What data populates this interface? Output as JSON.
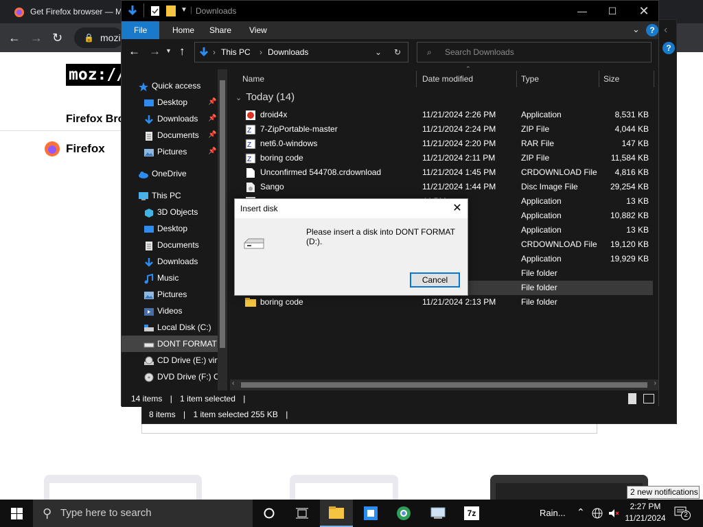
{
  "firefox": {
    "tab_title": "Get Firefox browser — M",
    "url_fragment": "mozil",
    "logo_text": "moz://a",
    "heading": "Firefox Bro",
    "brand": "Firefox"
  },
  "explorer_back": {
    "status_items": "8 items",
    "status_selected": "1 item selected  255 KB"
  },
  "explorer": {
    "title": "Downloads",
    "ribbon_tabs": [
      "File",
      "Home",
      "Share",
      "View"
    ],
    "breadcrumb": [
      "This PC",
      "Downloads"
    ],
    "search_placeholder": "Search Downloads",
    "nav": [
      {
        "label": "Quick access",
        "icon": "star-icon"
      },
      {
        "label": "Desktop",
        "icon": "desktop-folder-icon",
        "pinned": true
      },
      {
        "label": "Downloads",
        "icon": "download-arrow-icon",
        "pinned": true
      },
      {
        "label": "Documents",
        "icon": "documents-icon",
        "pinned": true
      },
      {
        "label": "Pictures",
        "icon": "pictures-icon",
        "pinned": true
      },
      {
        "label": "OneDrive",
        "icon": "cloud-icon"
      },
      {
        "label": "This PC",
        "icon": "computer-icon"
      },
      {
        "label": "3D Objects",
        "icon": "cube-icon"
      },
      {
        "label": "Desktop",
        "icon": "desktop-folder-icon"
      },
      {
        "label": "Documents",
        "icon": "documents-icon"
      },
      {
        "label": "Downloads",
        "icon": "download-arrow-icon"
      },
      {
        "label": "Music",
        "icon": "music-icon"
      },
      {
        "label": "Pictures",
        "icon": "pictures-icon"
      },
      {
        "label": "Videos",
        "icon": "videos-icon"
      },
      {
        "label": "Local Disk (C:)",
        "icon": "local-disk-icon"
      },
      {
        "label": "DONT FORMAT (",
        "icon": "removable-drive-icon",
        "selected": true
      },
      {
        "label": "CD Drive (E:) virt",
        "icon": "cd-drive-icon"
      },
      {
        "label": "DVD Drive (F:) Cl",
        "icon": "dvd-drive-icon"
      }
    ],
    "columns": [
      "Name",
      "Date modified",
      "Type",
      "Size"
    ],
    "group_label": "Today (14)",
    "files": [
      {
        "name": "droid4x",
        "date": "11/21/2024 2:26 PM",
        "type": "Application",
        "size": "8,531 KB",
        "icon": "app-icon"
      },
      {
        "name": "7-ZipPortable-master",
        "date": "11/21/2024 2:24 PM",
        "type": "ZIP File",
        "size": "4,044 KB",
        "icon": "archive-icon"
      },
      {
        "name": "net6.0-windows",
        "date": "11/21/2024 2:20 PM",
        "type": "RAR File",
        "size": "147 KB",
        "icon": "archive-icon"
      },
      {
        "name": "boring code",
        "date": "11/21/2024 2:11 PM",
        "type": "ZIP File",
        "size": "11,584 KB",
        "icon": "archive-icon"
      },
      {
        "name": "Unconfirmed 544708.crdownload",
        "date": "11/21/2024 1:45 PM",
        "type": "CRDOWNLOAD File",
        "size": "4,816 KB",
        "icon": "file-icon"
      },
      {
        "name": "Sango",
        "date": "11/21/2024 1:44 PM",
        "type": "Disc Image File",
        "size": "29,254 KB",
        "icon": "disc-image-icon"
      },
      {
        "name": "",
        "date": "44 PM",
        "type": "Application",
        "size": "13 KB",
        "icon": "app-icon"
      },
      {
        "name": "",
        "date": "18 PM",
        "type": "Application",
        "size": "10,882 KB",
        "icon": "app-icon"
      },
      {
        "name": "",
        "date": "2:59 PM",
        "type": "Application",
        "size": "13 KB",
        "icon": "app-icon"
      },
      {
        "name": "",
        "date": "2:58 PM",
        "type": "CRDOWNLOAD File",
        "size": "19,120 KB",
        "icon": "file-icon"
      },
      {
        "name": "",
        "date": "2:55 PM",
        "type": "Application",
        "size": "19,929 KB",
        "icon": "app-icon"
      },
      {
        "name": "",
        "date": "27 PM",
        "type": "File folder",
        "size": "",
        "icon": "folder-icon"
      },
      {
        "name": "",
        "date": "26 PM",
        "type": "File folder",
        "size": "",
        "icon": "folder-icon",
        "selected": true
      },
      {
        "name": "boring code",
        "date": "11/21/2024 2:13 PM",
        "type": "File folder",
        "size": "",
        "icon": "folder-icon"
      }
    ],
    "status_items": "14 items",
    "status_selected": "1 item selected"
  },
  "dialog": {
    "title": "Insert disk",
    "message": "Please insert a disk into DONT FORMAT (D:).",
    "cancel_label": "Cancel"
  },
  "taskbar": {
    "search_placeholder": "Type here to search",
    "weather": "Rain...",
    "time": "2:27 PM",
    "date": "11/21/2024",
    "notification_count": "2",
    "notification_tooltip": "2 new notifications"
  }
}
